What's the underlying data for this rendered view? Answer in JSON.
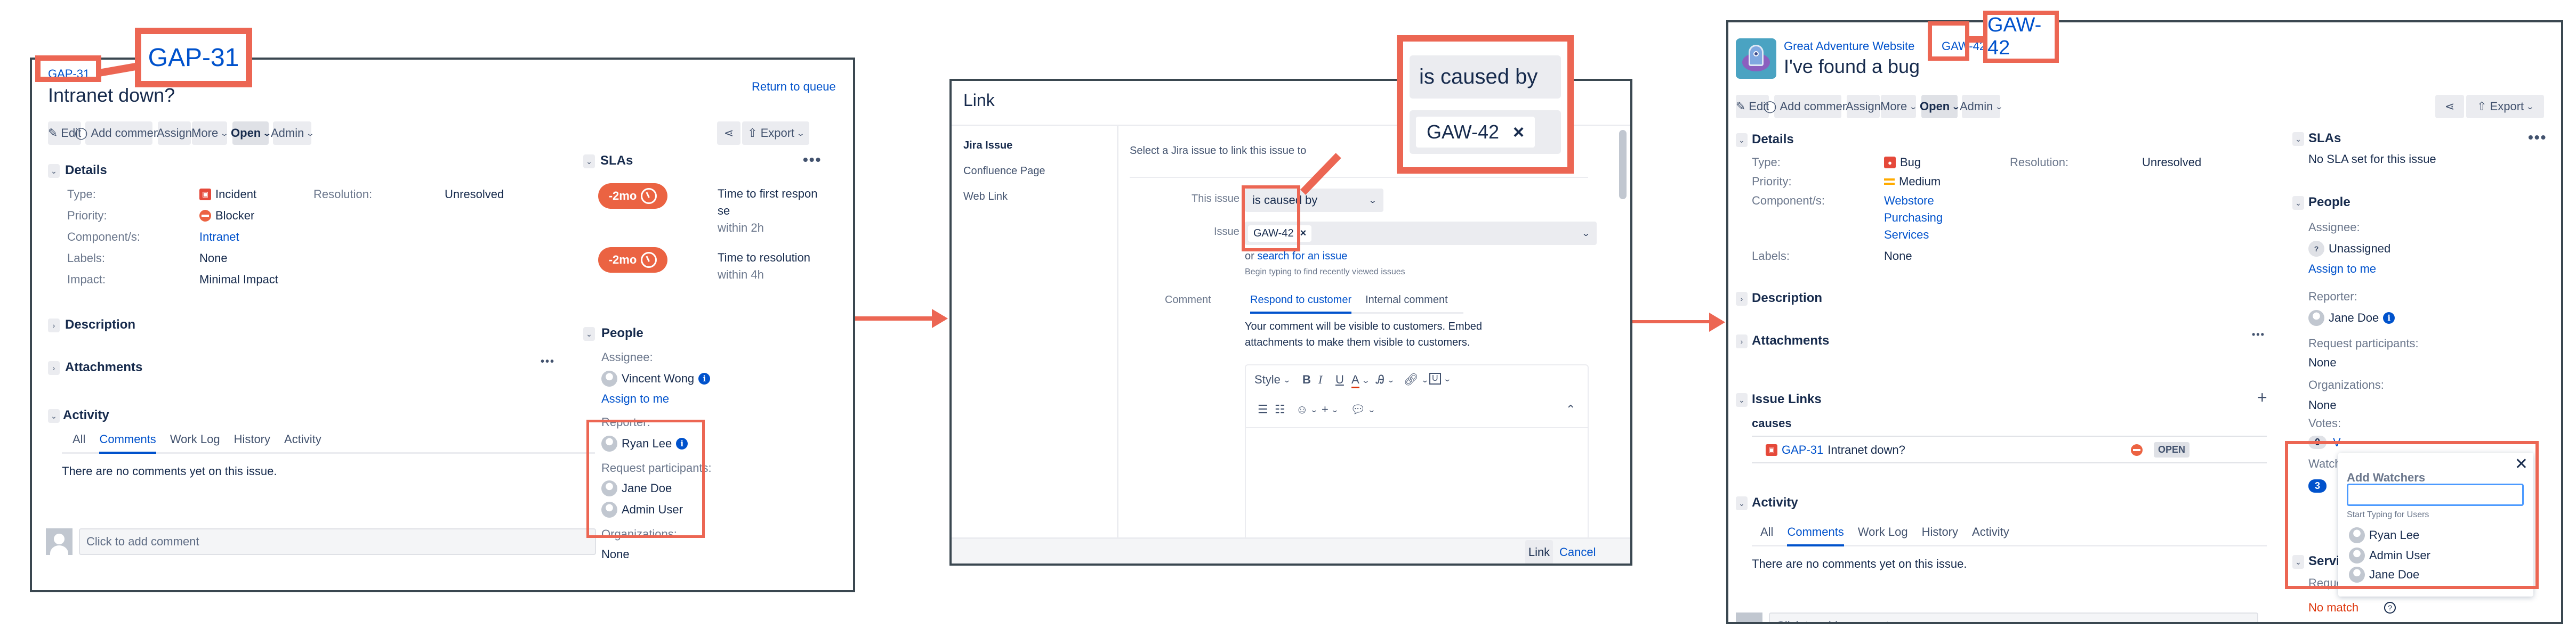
{
  "colors": {
    "accent": "#0052cc",
    "annotation": "#ec6653",
    "sla_breached": "#eb6342",
    "panel_border": "#3a4750"
  },
  "panel1": {
    "issue_key": "GAP-31",
    "callout_key": "GAP-31",
    "title": "Intranet down?",
    "return_link": "Return to queue",
    "toolbar": {
      "edit": "Edit",
      "add_comment": "Add comment",
      "assign": "Assign",
      "more": "More",
      "status": "Open",
      "admin": "Admin",
      "export": "Export"
    },
    "details": {
      "heading": "Details",
      "type_label": "Type:",
      "type_value": "Incident",
      "resolution_label": "Resolution:",
      "resolution_value": "Unresolved",
      "priority_label": "Priority:",
      "priority_value": "Blocker",
      "components_label": "Component/s:",
      "components": [
        "Intranet"
      ],
      "labels_label": "Labels:",
      "labels_value": "None",
      "impact_label": "Impact:",
      "impact_value": "Minimal Impact"
    },
    "description_heading": "Description",
    "attachments_heading": "Attachments",
    "activity": {
      "heading": "Activity",
      "tabs": [
        "All",
        "Comments",
        "Work Log",
        "History",
        "Activity"
      ],
      "active_tab": "Comments",
      "empty": "There are no comments yet on this issue.",
      "comment_placeholder": "Click to add comment"
    },
    "slas": {
      "heading": "SLAs",
      "items": [
        {
          "badge": "-2mo",
          "name_line1": "Time to first respon",
          "name_line2": "se",
          "goal": "within 2h"
        },
        {
          "badge": "-2mo",
          "name_line1": "Time to resolution",
          "name_line2": "",
          "goal": "within 4h"
        }
      ]
    },
    "people": {
      "heading": "People",
      "assignee_label": "Assignee:",
      "assignee": "Vincent Wong",
      "assign_to_me": "Assign to me",
      "reporter_label": "Reporter:",
      "reporter": "Ryan Lee",
      "participants_label": "Request participants:",
      "participants": [
        "Jane Doe",
        "Admin User"
      ],
      "organizations_label": "Organizations:",
      "organizations_value": "None"
    }
  },
  "panel2": {
    "title": "Link",
    "nav": [
      "Jira Issue",
      "Confluence Page",
      "Web Link"
    ],
    "active_nav": "Jira Issue",
    "intro": "Select a Jira issue to link this issue to",
    "this_issue_label": "This issue",
    "link_type": "is caused by",
    "issue_label": "Issue",
    "issue_chip": "GAW-42",
    "or_text": "or",
    "search_link": "search for an issue",
    "hint": "Begin typing to find recently viewed issues",
    "comment_label": "Comment",
    "comment_tabs": [
      "Respond to customer",
      "Internal comment"
    ],
    "active_comment_tab": "Respond to customer",
    "comment_notice_line1": "Your comment will be visible to customers. Embed",
    "comment_notice_line2": "attachments to make them visible to customers.",
    "editor": {
      "style": "Style",
      "bold": "B",
      "italic": "I",
      "underline": "U",
      "color": "A"
    },
    "callout_link_type": "is caused by",
    "callout_chip": "GAW-42",
    "link_button": "Link",
    "cancel": "Cancel"
  },
  "panel3": {
    "project": "Great Adventure Website",
    "issue_key": "GAW-42",
    "callout_key": "GAW-42",
    "title": "I've found a bug",
    "toolbar": {
      "edit": "Edit",
      "add_comment": "Add comment",
      "assign": "Assign",
      "more": "More",
      "status": "Open",
      "admin": "Admin",
      "export": "Export"
    },
    "details": {
      "heading": "Details",
      "type_label": "Type:",
      "type_value": "Bug",
      "resolution_label": "Resolution:",
      "resolution_value": "Unresolved",
      "priority_label": "Priority:",
      "priority_value": "Medium",
      "components_label": "Component/s:",
      "components": [
        "Webstore",
        "Purchasing",
        "Services"
      ],
      "labels_label": "Labels:",
      "labels_value": "None"
    },
    "description_heading": "Description",
    "attachments_heading": "Attachments",
    "issue_links": {
      "heading": "Issue Links",
      "relation": "causes",
      "items": [
        {
          "key": "GAP-31",
          "summary": "Intranet down?",
          "status": "OPEN"
        }
      ]
    },
    "activity": {
      "heading": "Activity",
      "tabs": [
        "All",
        "Comments",
        "Work Log",
        "History",
        "Activity"
      ],
      "active_tab": "Comments",
      "empty": "There are no comments yet on this issue.",
      "comment_placeholder": "Click to add comment"
    },
    "slas": {
      "heading": "SLAs",
      "empty": "No SLA set for this issue"
    },
    "people": {
      "heading": "People",
      "assignee_label": "Assignee:",
      "assignee": "Unassigned",
      "assign_to_me": "Assign to me",
      "reporter_label": "Reporter:",
      "reporter": "Jane Doe",
      "participants_label": "Request participants:",
      "participants_value": "None",
      "organizations_label": "Organizations:",
      "organizations_value": "None",
      "votes_label": "Votes:",
      "votes_count": "0",
      "watchers_label": "Watchers:",
      "watchers_count": "3"
    },
    "service_heading": "Service",
    "request_type_label": "Request type:",
    "no_match": "No match",
    "watchers_popup": {
      "title": "Add Watchers",
      "input_value": "",
      "hint": "Start Typing for Users",
      "users": [
        "Ryan Lee",
        "Admin User",
        "Jane Doe"
      ]
    }
  }
}
